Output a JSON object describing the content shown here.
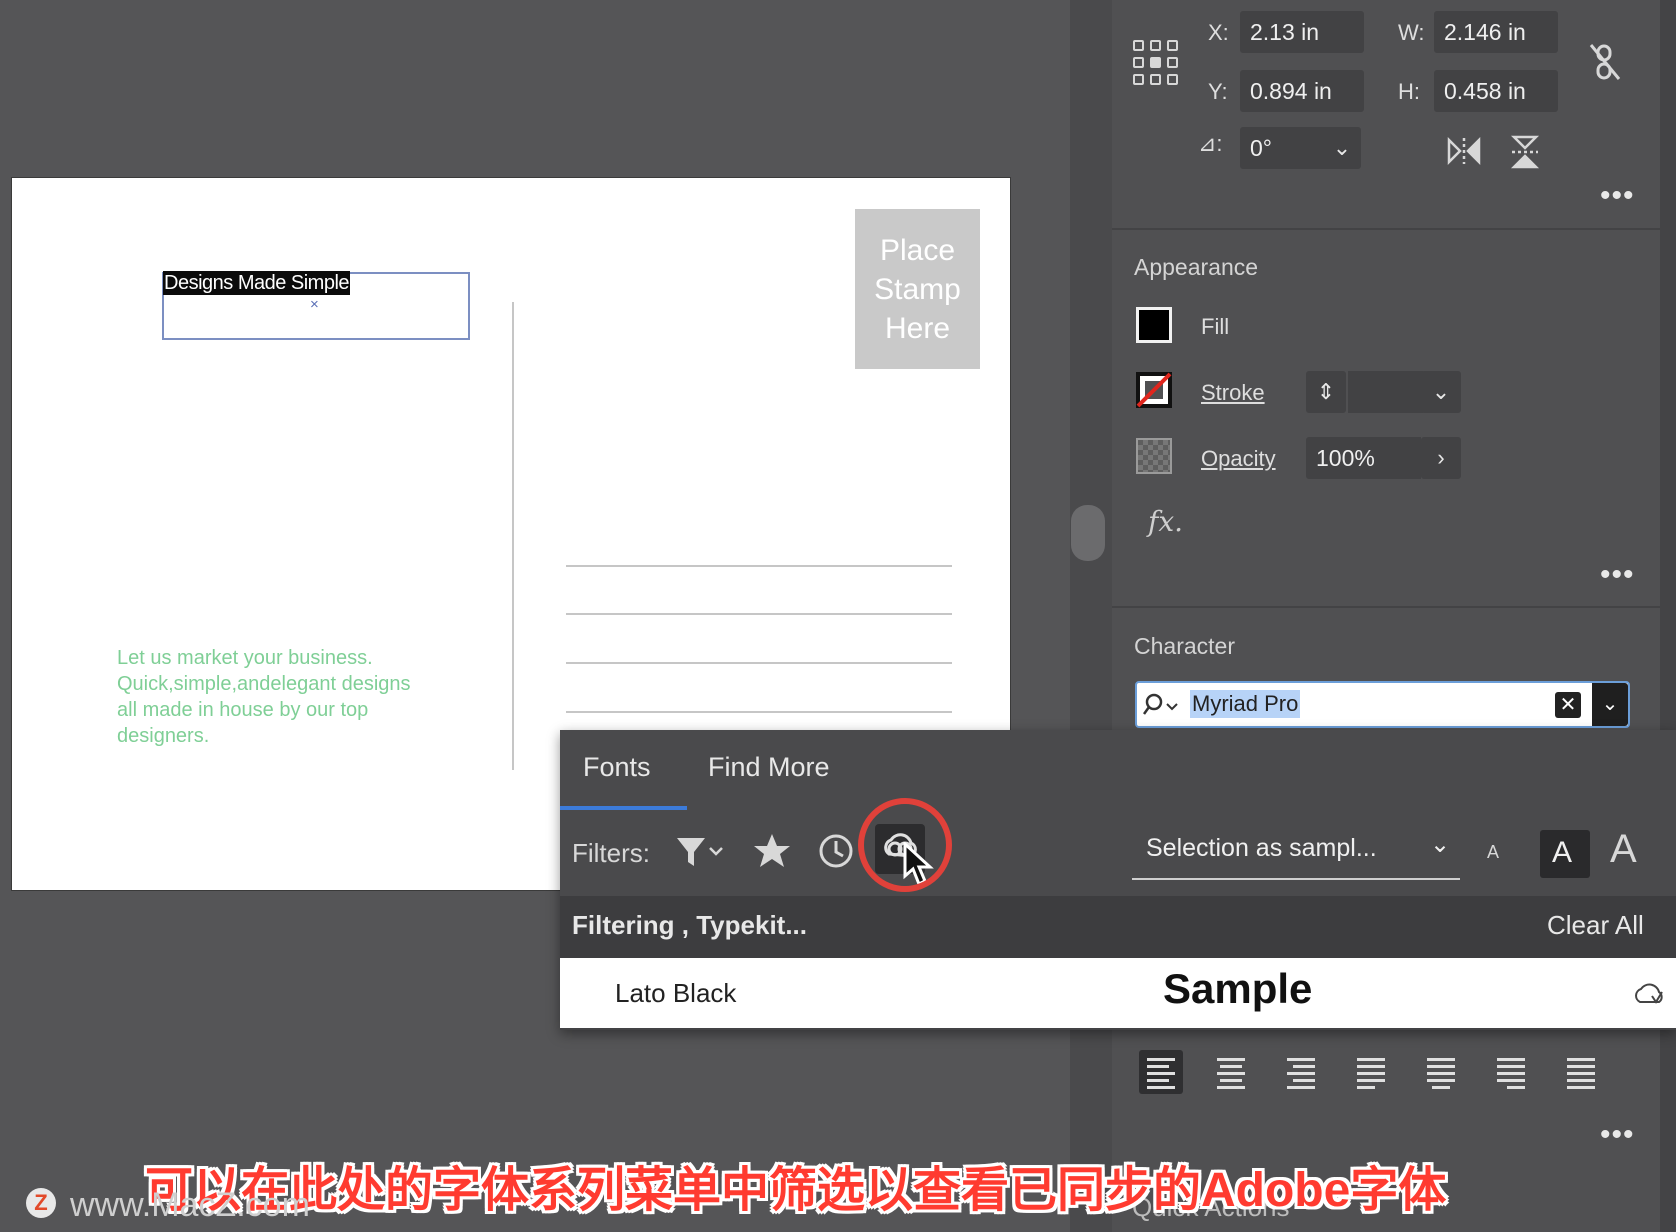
{
  "artboard": {
    "stamp_lines": [
      "Place",
      "Stamp",
      "Here"
    ],
    "headline": "Designs Made Simple",
    "anchor_mark": "×",
    "body_text": "Let us market your business. Quick,simple,andelegant designs all made in house by our top designers.",
    "address_lines": 4
  },
  "transform": {
    "x_label": "X:",
    "x_value": "2.13 in",
    "y_label": "Y:",
    "y_value": "0.894 in",
    "w_label": "W:",
    "w_value": "2.146 in",
    "h_label": "H:",
    "h_value": "0.458 in",
    "rotate_label": "⊿:",
    "rotate_value": "0°",
    "more": "•••"
  },
  "appearance": {
    "title": "Appearance",
    "fill_label": "Fill",
    "stroke_label": "Stroke",
    "opacity_label": "Opacity",
    "opacity_value": "100%",
    "fx_label": "fx.",
    "more": "•••",
    "fill_color": "#000000"
  },
  "character": {
    "title": "Character",
    "font_value": "Myriad Pro"
  },
  "font_popup": {
    "tabs": [
      "Fonts",
      "Find More"
    ],
    "filters_label": "Filters:",
    "sample_select": "Selection as sampl...",
    "size_small": "A",
    "size_medium": "A",
    "size_large": "A",
    "filtering_text": "Filtering , Typekit...",
    "clear_all": "Clear All",
    "result_font": "Lato Black",
    "result_sample": "Sample",
    "active_tab_color": "#3c7bd9"
  },
  "paragraph": {
    "more": "•••"
  },
  "quick_actions": "Quick Actions",
  "caption": "可以在此处的字体系列菜单中筛选以查看已同步的Adobe字体",
  "watermark": {
    "logo": "Z",
    "text": "www.MacZ.com"
  },
  "highlight_color": "#e0413a"
}
